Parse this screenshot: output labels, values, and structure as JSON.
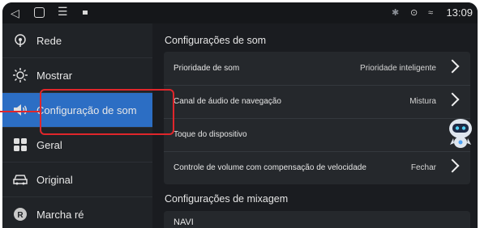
{
  "status_bar": {
    "icons": [
      "back-icon",
      "home-icon",
      "menu-icon",
      "app-icon",
      "bluetooth-icon",
      "location-icon",
      "wifi-icon"
    ],
    "time": "13:09"
  },
  "sidebar": {
    "items": [
      {
        "label": "Rede",
        "icon": "network-icon"
      },
      {
        "label": "Mostrar",
        "icon": "brightness-icon"
      },
      {
        "label": "Configuração de som",
        "icon": "speaker-icon",
        "active": true
      },
      {
        "label": "Geral",
        "icon": "grid-icon"
      },
      {
        "label": "Original",
        "icon": "car-icon"
      },
      {
        "label": "Marcha ré",
        "icon": "reverse-icon"
      }
    ]
  },
  "main": {
    "sound_title": "Configurações de som",
    "rows": [
      {
        "label": "Prioridade de som",
        "value": "Prioridade inteligente"
      },
      {
        "label": "Canal de áudio de navegação",
        "value": "Mistura"
      },
      {
        "label": "Toque do dispositivo",
        "value": ""
      },
      {
        "label": "Controle de volume com compensação de velocidade",
        "value": "Fechar"
      }
    ],
    "mix_title": "Configurações de mixagem",
    "mix_item": "NAVI"
  },
  "colors": {
    "accent": "#2c6ec4",
    "highlight": "#e0262b",
    "background": "#1a1c20"
  }
}
